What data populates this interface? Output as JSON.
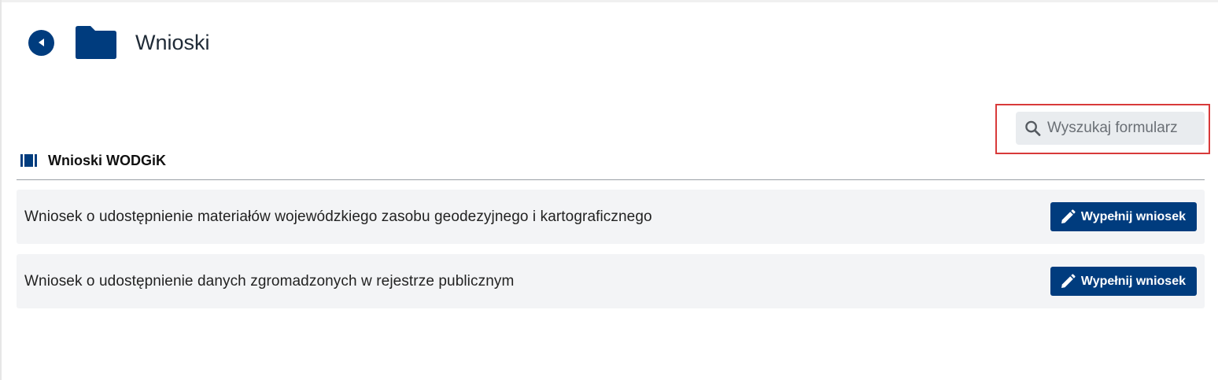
{
  "header": {
    "title": "Wnioski",
    "back_icon": "back-circle-icon",
    "folder_icon": "folder-icon"
  },
  "search": {
    "placeholder": "Wyszukaj formularz",
    "icon": "search-icon"
  },
  "section": {
    "title": "Wnioski WODGiK",
    "icon": "book-icon"
  },
  "items": [
    {
      "label": "Wniosek o udostępnienie materiałów wojewódzkiego zasobu geodezyjnego i kartograficznego",
      "button_label": "Wypełnij wniosek"
    },
    {
      "label": "Wniosek o udostępnienie danych zgromadzonych w rejestrze publicznym",
      "button_label": "Wypełnij wniosek"
    }
  ],
  "colors": {
    "primary": "#003c7e",
    "highlight": "#d83a3a",
    "row_background": "#f3f4f6",
    "search_background": "#e9ecef"
  }
}
